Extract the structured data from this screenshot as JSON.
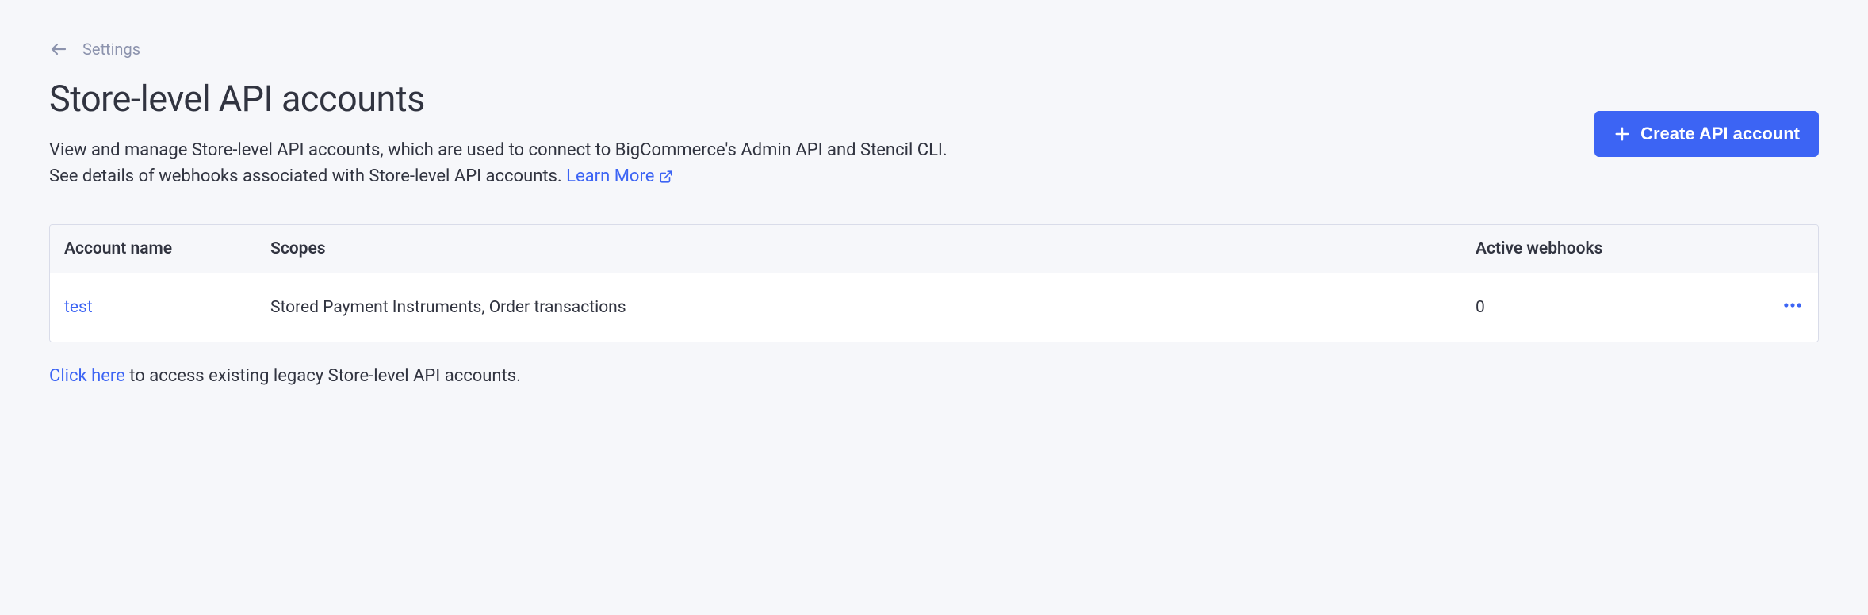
{
  "breadcrumb": {
    "label": "Settings"
  },
  "header": {
    "title": "Store-level API accounts",
    "description_part1": "View and manage Store-level API accounts, which are used to connect to BigCommerce's Admin API and Stencil CLI. See details of webhooks associated with Store-level API accounts. ",
    "learn_more_label": "Learn More",
    "create_button_label": "Create API account"
  },
  "table": {
    "columns": {
      "account_name": "Account name",
      "scopes": "Scopes",
      "active_webhooks": "Active webhooks"
    },
    "rows": [
      {
        "name": "test",
        "scopes": "Stored Payment Instruments, Order transactions",
        "active_webhooks": "0"
      }
    ]
  },
  "legacy": {
    "link_label": "Click here",
    "text": " to access existing legacy Store-level API accounts."
  }
}
